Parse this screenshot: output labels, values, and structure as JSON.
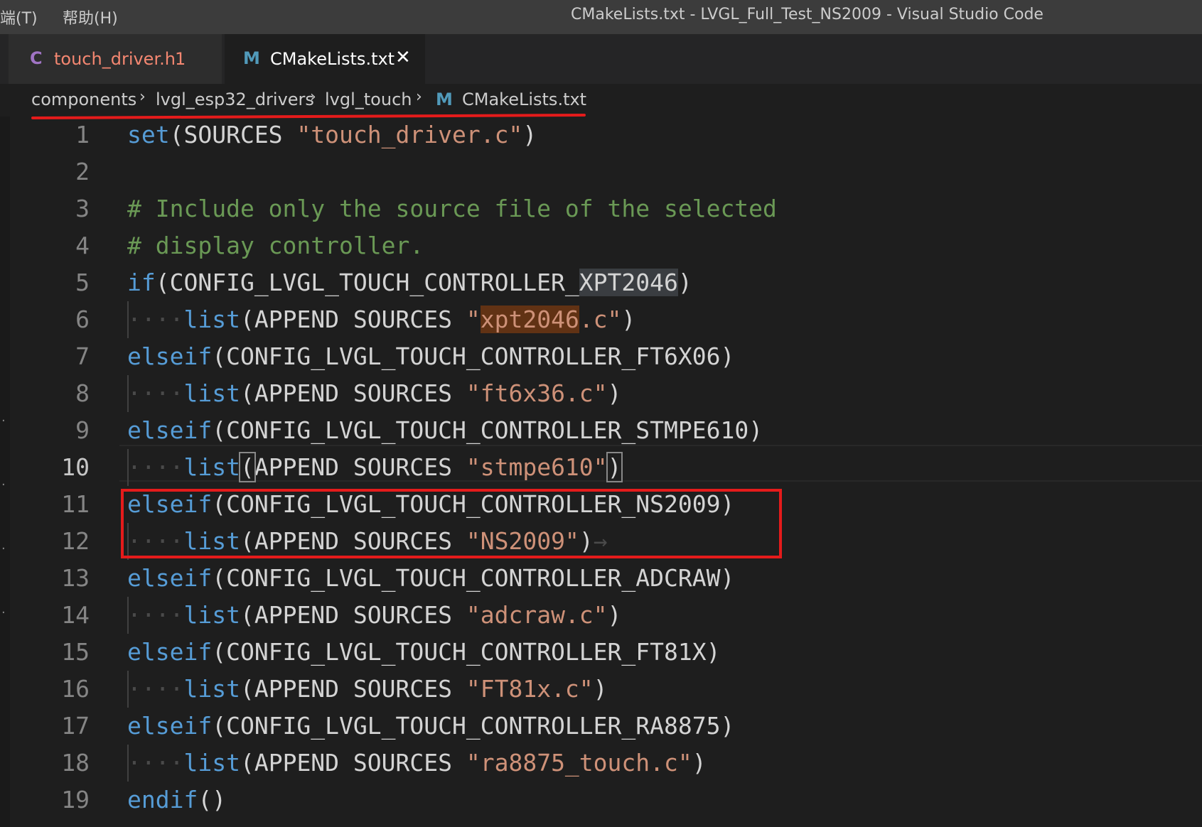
{
  "menu": {
    "terminal": "端(T)",
    "help": "帮助(H)"
  },
  "window_title": "CMakeLists.txt - LVGL_Full_Test_NS2009 - Visual Studio Code",
  "tabs": [
    {
      "icon": "C",
      "label": "touch_driver.h",
      "badge": "1",
      "icon_color": "#a074c4",
      "label_color": "#f48771"
    },
    {
      "icon": "M",
      "label": "CMakeLists.txt",
      "close": "✕",
      "icon_color": "#519aba",
      "label_color": "#ffffff"
    }
  ],
  "breadcrumb": {
    "items": [
      "components",
      "lvgl_esp32_drivers",
      "lvgl_touch"
    ],
    "file_icon": "M",
    "file": "CMakeLists.txt",
    "separator": "›"
  },
  "editor": {
    "active_line": "10",
    "lines": [
      {
        "n": "1",
        "kw": "set",
        "t1": "(SOURCES ",
        "s": "\"touch_driver.c\"",
        "t2": ")"
      },
      {
        "n": "2"
      },
      {
        "n": "3",
        "comment": "# Include only the source file of the selected"
      },
      {
        "n": "4",
        "comment": "# display controller."
      },
      {
        "n": "5",
        "kw": "if",
        "t1": "(CONFIG_LVGL_TOUCH_CONTROLLER_",
        "sel": "XPT2046",
        "t2": ")"
      },
      {
        "n": "6",
        "ind": "····",
        "kw": "list",
        "t1": "(APPEND SOURCES ",
        "q": "\"",
        "hl": "xpt2046",
        "s": ".c\"",
        "t2": ")"
      },
      {
        "n": "7",
        "kw": "elseif",
        "t1": "(CONFIG_LVGL_TOUCH_CONTROLLER_FT6X06)"
      },
      {
        "n": "8",
        "ind": "····",
        "kw": "list",
        "t1": "(APPEND SOURCES ",
        "s": "\"ft6x36.c\"",
        "t2": ")"
      },
      {
        "n": "9",
        "kw": "elseif",
        "t1": "(CONFIG_LVGL_TOUCH_CONTROLLER_STMPE610)"
      },
      {
        "n": "10",
        "ind": "····",
        "kw": "list",
        "b1": "(",
        "t1": "APPEND SOURCES ",
        "s": "\"stmpe610\"",
        "b2": ")"
      },
      {
        "n": "11",
        "kw": "elseif",
        "t1": "(CONFIG_LVGL_TOUCH_CONTROLLER_NS2009)"
      },
      {
        "n": "12",
        "ind": "····",
        "kw": "list",
        "t1": "(APPEND SOURCES ",
        "s": "\"NS2009\"",
        "t2": ")",
        "tail": "→"
      },
      {
        "n": "13",
        "kw": "elseif",
        "t1": "(CONFIG_LVGL_TOUCH_CONTROLLER_ADCRAW)"
      },
      {
        "n": "14",
        "ind": "····",
        "kw": "list",
        "t1": "(APPEND SOURCES ",
        "s": "\"adcraw.c\"",
        "t2": ")"
      },
      {
        "n": "15",
        "kw": "elseif",
        "t1": "(CONFIG_LVGL_TOUCH_CONTROLLER_FT81X)"
      },
      {
        "n": "16",
        "ind": "····",
        "kw": "list",
        "t1": "(APPEND SOURCES ",
        "s": "\"FT81x.c\"",
        "t2": ")"
      },
      {
        "n": "17",
        "kw": "elseif",
        "t1": "(CONFIG_LVGL_TOUCH_CONTROLLER_RA8875)"
      },
      {
        "n": "18",
        "ind": "····",
        "kw": "list",
        "t1": "(APPEND SOURCES ",
        "s": "\"ra8875_touch.c\"",
        "t2": ")"
      },
      {
        "n": "19",
        "kw": "endif",
        "t1": "()"
      }
    ]
  },
  "colors": {
    "annotation": "#e51b1b",
    "keyword": "#569cd6",
    "string": "#ce9178",
    "comment": "#6a9955"
  }
}
